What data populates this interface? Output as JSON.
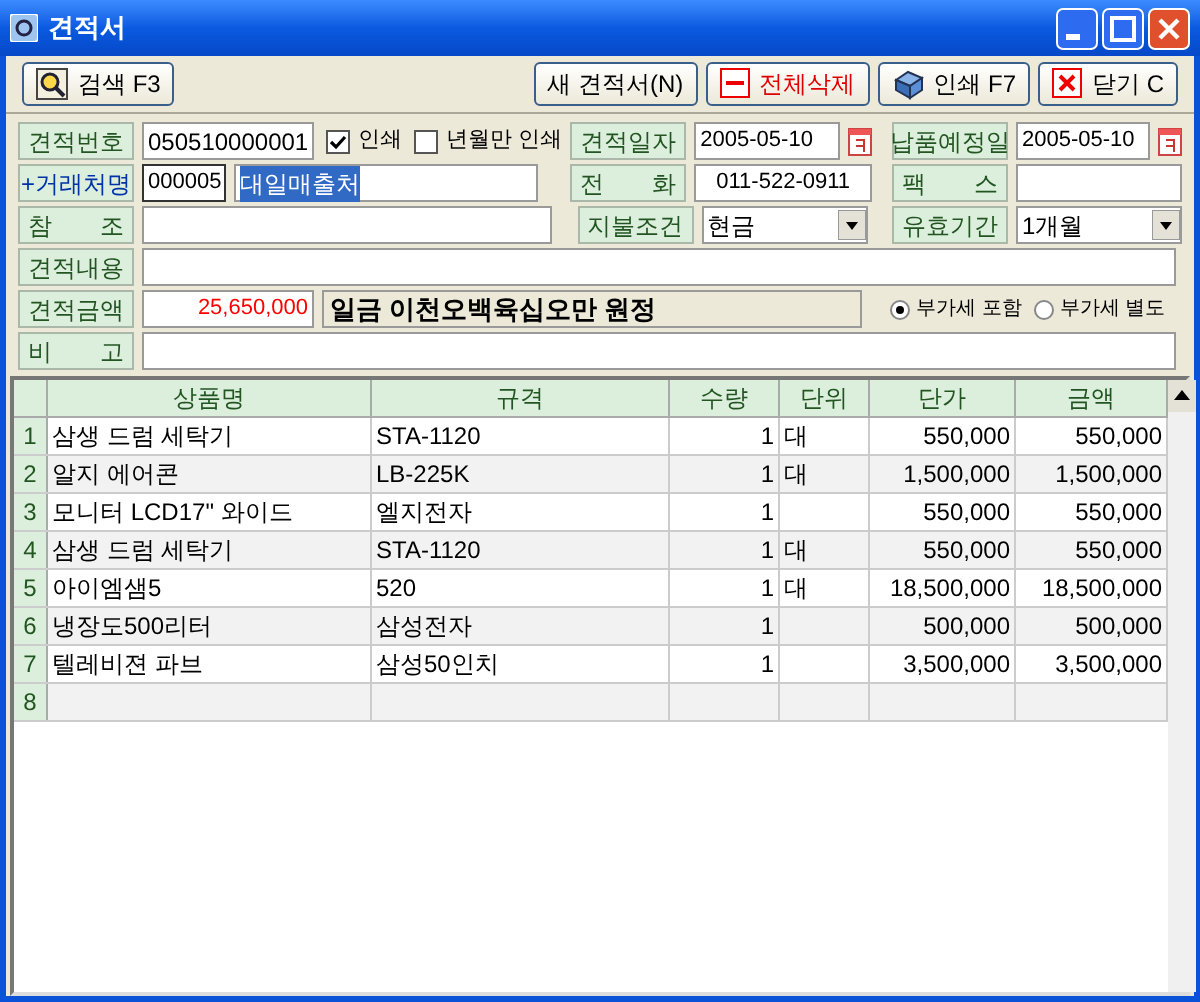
{
  "window": {
    "title": "견적서"
  },
  "toolbar": {
    "left": [
      {
        "label": "검색 F3",
        "kind": "search"
      }
    ],
    "right": [
      {
        "label": "새 견적서(N)",
        "kind": "plain",
        "danger": false
      },
      {
        "label": "전체삭제",
        "kind": "minus",
        "danger": true
      },
      {
        "label": "인쇄 F7",
        "kind": "print",
        "danger": false
      },
      {
        "label": "닫기 C",
        "kind": "close",
        "danger": false
      }
    ]
  },
  "form": {
    "quote_no": {
      "label": "견적번호",
      "value": "050510000001"
    },
    "print": {
      "label": "인쇄",
      "checked": true
    },
    "print_month": {
      "label": "년월만 인쇄",
      "checked": false
    },
    "quote_date": {
      "label": "견적일자",
      "value": "2005-05-10"
    },
    "delivery_date": {
      "label": "납품예정일",
      "value": "2005-05-10"
    },
    "client": {
      "label": "+거래처명",
      "code": "000005",
      "value": "대일매출처",
      "text_selected": true
    },
    "phone": {
      "label": "전　　화",
      "value": "011-522-0911"
    },
    "fax": {
      "label": "팩　　스"
    },
    "reference": {
      "label": "참　　조"
    },
    "payment": {
      "label": "지불조건",
      "value": "현금"
    },
    "validity": {
      "label": "유효기간",
      "value": "1개월"
    },
    "content": {
      "label": "견적내용"
    },
    "amount": {
      "label": "견적금액",
      "value": "25,650,000",
      "words": "일금 이천오백육십오만 원정"
    },
    "vat": [
      {
        "label": "부가세 포함",
        "selected": true
      },
      {
        "label": "부가세 별도",
        "selected": false
      }
    ],
    "note": {
      "label": "비　　고"
    }
  },
  "table": {
    "columns": [
      "상품명",
      "규격",
      "수량",
      "단위",
      "단가",
      "금액"
    ],
    "rows": [
      {
        "no": "1",
        "cells": [
          "삼생 드럼 세탁기",
          "STA-1120",
          "1",
          "대",
          "550,000",
          "550,000"
        ]
      },
      {
        "no": "2",
        "cells": [
          "알지 에어콘",
          "LB-225K",
          "1",
          "대",
          "1,500,000",
          "1,500,000"
        ]
      },
      {
        "no": "3",
        "cells": [
          "모니터 LCD17\" 와이드",
          "엘지전자",
          "1",
          null,
          "550,000",
          "550,000"
        ]
      },
      {
        "no": "4",
        "cells": [
          "삼생 드럼 세탁기",
          "STA-1120",
          "1",
          "대",
          "550,000",
          "550,000"
        ]
      },
      {
        "no": "5",
        "cells": [
          "아이엠샘5",
          "520",
          "1",
          "대",
          "18,500,000",
          "18,500,000"
        ]
      },
      {
        "no": "6",
        "cells": [
          "냉장도500리터",
          "삼성전자",
          "1",
          null,
          "500,000",
          "500,000"
        ]
      },
      {
        "no": "7",
        "cells": [
          "텔레비젼 파브",
          "삼성50인치",
          "1",
          null,
          "3,500,000",
          "3,500,000"
        ]
      },
      {
        "no": "8",
        "cells": [
          null,
          null,
          null,
          null,
          null,
          null
        ]
      }
    ]
  }
}
